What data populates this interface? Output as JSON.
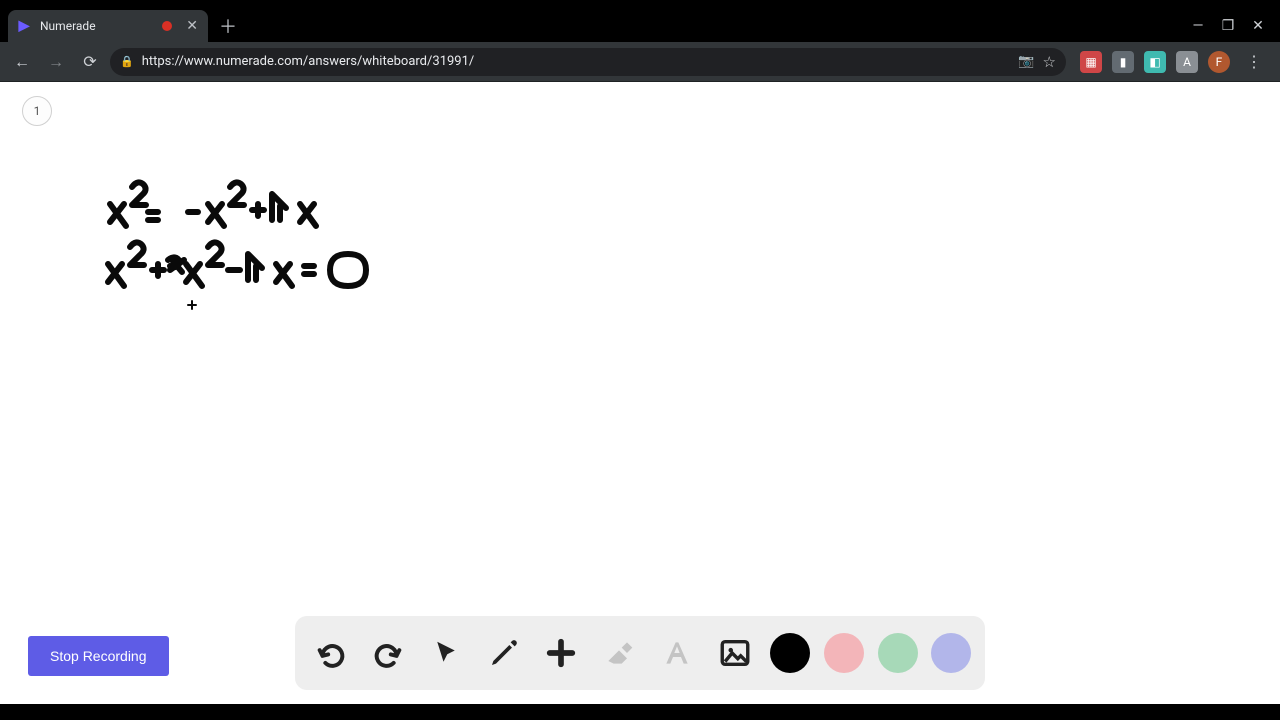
{
  "browser": {
    "tab_title": "Numerade",
    "new_tab_glyph": "＋",
    "close_glyph": "✕",
    "minimize_glyph": "—",
    "maxrestore_glyph": "❐",
    "window_close_glyph": "✕",
    "back_glyph": "←",
    "forward_glyph": "→",
    "reload_glyph": "⟳",
    "lock_glyph": "🔒",
    "url": "https://www.numerade.com/answers/whiteboard/31991/",
    "camera_glyph": "📷",
    "star_glyph": "☆",
    "menu_glyph": "⋮",
    "avatar_letter": "F"
  },
  "ext": {
    "e1_glyph": "▦",
    "e2_glyph": "▮",
    "e3_glyph": "◧",
    "e4_glyph": "A"
  },
  "page": {
    "page_number": "1",
    "stop_recording_label": "Stop Recording"
  },
  "handwriting": {
    "line1": "x² = -x² + 4x",
    "line2": "x² + x² - 4x = 0"
  },
  "tools": {
    "undo": "undo",
    "redo": "redo",
    "pointer": "pointer",
    "pen": "pen",
    "add": "add-shape",
    "eraser": "eraser",
    "text": "text",
    "image": "image"
  },
  "colors": {
    "black": "#000000",
    "pink": "#f3b5b9",
    "green": "#a7d9b8",
    "lavender": "#b2b6ea"
  }
}
